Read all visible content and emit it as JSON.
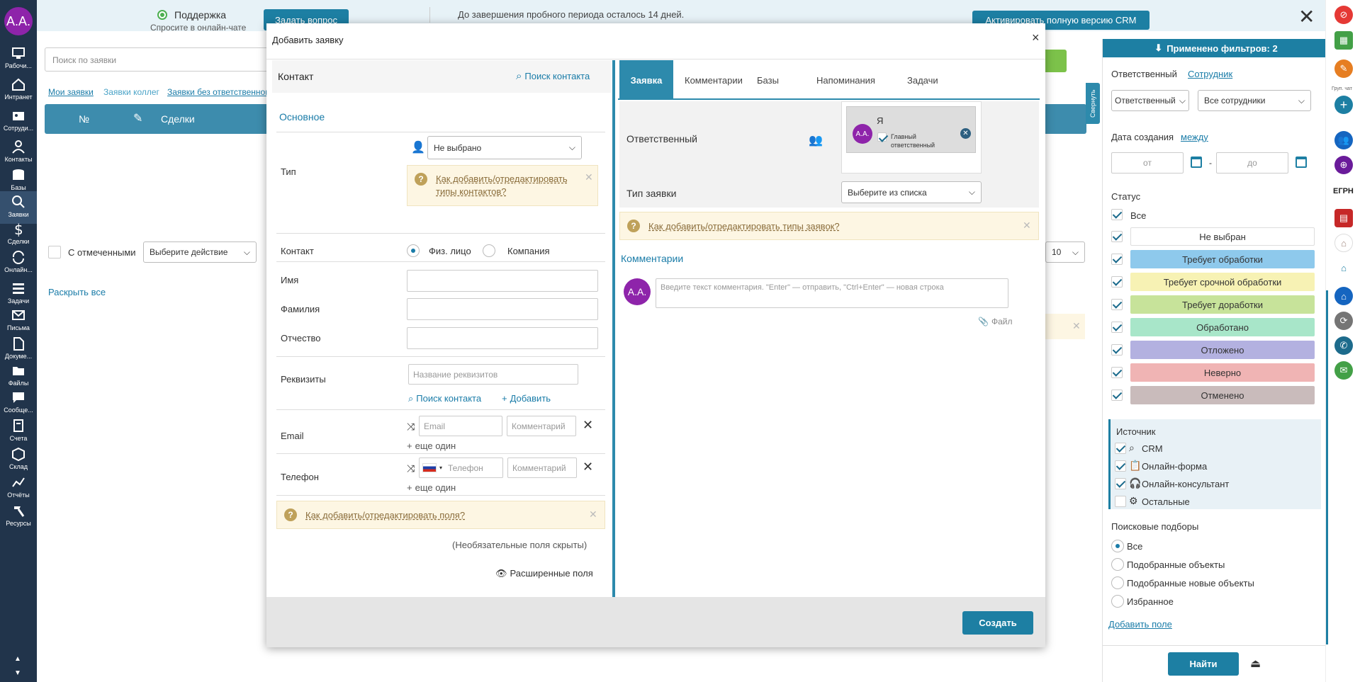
{
  "colors": {
    "nav": "#21344b",
    "accent": "#1d7fa3",
    "modal_tab_active": "#2d8aac",
    "avatar": "#8e24aa",
    "hint_bg": "#fdf6e3"
  },
  "user": {
    "initials": "A.A."
  },
  "nav": [
    {
      "label": "Рабочи...",
      "icon": "desktop-icon"
    },
    {
      "label": "Интранет",
      "icon": "home-icon"
    },
    {
      "label": "Сотруди...",
      "icon": "id-card-icon"
    },
    {
      "label": "Контакты",
      "icon": "person-icon"
    },
    {
      "label": "Базы",
      "icon": "database-icon"
    },
    {
      "label": "Заявки",
      "icon": "search-icon"
    },
    {
      "label": "Сделки",
      "icon": "dollar-icon"
    },
    {
      "label": "Онлайн...",
      "icon": "sync-icon"
    },
    {
      "label": "Задачи",
      "icon": "tasks-icon"
    },
    {
      "label": "Письма",
      "icon": "mail-icon"
    },
    {
      "label": "Докуме...",
      "icon": "document-icon"
    },
    {
      "label": "Файлы",
      "icon": "folder-icon"
    },
    {
      "label": "Сообще...",
      "icon": "chat-icon"
    },
    {
      "label": "Счета",
      "icon": "invoice-icon"
    },
    {
      "label": "Склад",
      "icon": "box-icon"
    },
    {
      "label": "Отчёты",
      "icon": "chart-icon"
    },
    {
      "label": "Ресурсы",
      "icon": "hammer-icon"
    }
  ],
  "topbar": {
    "support_title": "Поддержка",
    "support_sub": "Спросите в онлайн-чате",
    "ask_button": "Задать вопрос",
    "trial_text": "До завершения пробного периода осталось 14 дней.",
    "activate_button": "Активировать полную версию CRM"
  },
  "background": {
    "search_placeholder": "Поиск по заявки",
    "links": [
      "Мои заявки",
      "Заявки коллег",
      "Заявки без ответственного"
    ],
    "table_headers": [
      "№",
      "Сделки"
    ],
    "with_selected": "С отмеченными",
    "action_select": "Выберите действие",
    "expand_all": "Раскрыть все",
    "page_size": "10",
    "collapse_tab": "Свернуть"
  },
  "modal": {
    "title": "Добавить заявку",
    "close": "×",
    "left": {
      "header": "Контакт",
      "search_contact": "Поиск контакта",
      "section": "Основное",
      "type_label": "Тип",
      "type_value": "Не выбрано",
      "type_hint": "Как добавить/отредактировать типы контактов?",
      "contact_label": "Контакт",
      "radio_person": "Физ. лицо",
      "radio_company": "Компания",
      "name_label": "Имя",
      "surname_label": "Фамилия",
      "patronymic_label": "Отчество",
      "requisites_label": "Реквизиты",
      "requisites_placeholder": "Название реквизитов",
      "requisites_search": "Поиск контакта",
      "requisites_add": "Добавить",
      "email_label": "Email",
      "email_placeholder": "Email",
      "comment_placeholder": "Комментарий",
      "one_more": "еще один",
      "phone_label": "Телефон",
      "phone_placeholder": "Телефон",
      "fields_hint": "Как добавить/отредактировать поля?",
      "hidden_note": "(Необязательные поля скрыты)",
      "extended": "Расширенные поля"
    },
    "right": {
      "tabs": [
        "Заявка",
        "Комментарии",
        "Базы",
        "Напоминания",
        "Задачи"
      ],
      "responsible_label": "Ответственный",
      "responsible_name": "Я",
      "main_responsible": "Главный ответственный",
      "type_label": "Тип заявки",
      "type_select": "Выберите из списка",
      "type_hint": "Как добавить/отредактировать типы заявок?",
      "comments_title": "Комментарии",
      "comment_placeholder": "Введите текст комментария. \"Enter\" — отправить, \"Ctrl+Enter\" — новая строка",
      "file": "Файл"
    },
    "create_button": "Создать"
  },
  "filter": {
    "applied": "Применено фильтров: 2",
    "responsible_label": "Ответственный",
    "employee_link": "Сотрудник",
    "responsible_select": "Ответственный",
    "employees_select": "Все сотрудники",
    "created_label": "Дата создания",
    "between_link": "между",
    "from": "от",
    "to": "до",
    "status_label": "Статус",
    "status_all": "Все",
    "statuses": [
      {
        "label": "Не выбран",
        "color": "#ffffff"
      },
      {
        "label": "Требует обработки",
        "color": "#8ec9ec"
      },
      {
        "label": "Требует срочной обработки",
        "color": "#f7f2b4"
      },
      {
        "label": "Требует доработки",
        "color": "#c7e39a"
      },
      {
        "label": "Обработано",
        "color": "#a8e6c9"
      },
      {
        "label": "Отложено",
        "color": "#b3b1e0"
      },
      {
        "label": "Неверно",
        "color": "#f0b4b4"
      },
      {
        "label": "Отменено",
        "color": "#c9bbbb"
      }
    ],
    "source_label": "Источник",
    "sources": [
      {
        "label": "CRM",
        "checked": true
      },
      {
        "label": "Онлайн-форма",
        "checked": true
      },
      {
        "label": "Онлайн-консультант",
        "checked": true
      },
      {
        "label": "Остальные",
        "checked": false
      }
    ],
    "search_label": "Поисковые подборы",
    "search_options": [
      "Все",
      "Подобранные объекты",
      "Подобранные новые объекты",
      "Избранное"
    ],
    "add_field": "Добавить поле",
    "find_button": "Найти"
  },
  "rstrip": {
    "chat_label": "Груп. чат",
    "egrn": "ЕГРН"
  }
}
